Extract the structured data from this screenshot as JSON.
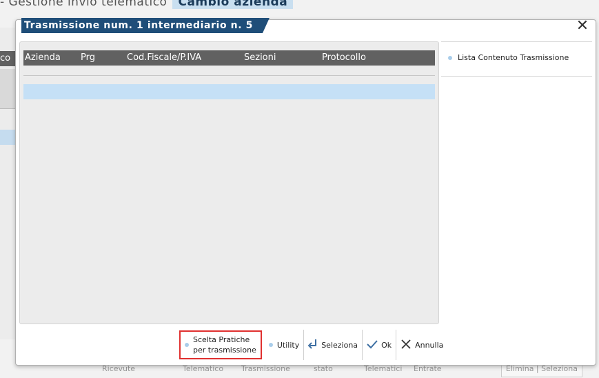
{
  "background": {
    "title_prefix": "- Gestione invio telematico",
    "title_active": "Cambio azienda",
    "left_header_fragment": "co",
    "bottom_labels": [
      "Ricevute",
      "Telematico",
      "Trasmissione",
      "stato",
      "Telematici",
      "Entrate"
    ],
    "right_buttons": [
      "Elimina",
      "Seleziona"
    ]
  },
  "dialog": {
    "title": "Trasmissione num.  1 intermediario n.  5",
    "close_glyph": "✕"
  },
  "grid": {
    "columns": [
      "Azienda",
      "Prg",
      "Cod.Fiscale/P.IVA",
      "Sezioni",
      "Protocollo"
    ],
    "rows": []
  },
  "side_panel": {
    "items": [
      {
        "label": "Lista Contenuto Trasmissione"
      }
    ]
  },
  "toolbar": {
    "scelta_line1": "Scelta Pratiche",
    "scelta_line2": "per trasmissione",
    "utility": "Utility",
    "seleziona": "Seleziona",
    "ok": "Ok",
    "annulla": "Annulla"
  },
  "colors": {
    "title_bar": "#1f4e79",
    "grid_header": "#616161",
    "selected_row": "#c5e0f6",
    "highlight_border": "#e0302f"
  }
}
